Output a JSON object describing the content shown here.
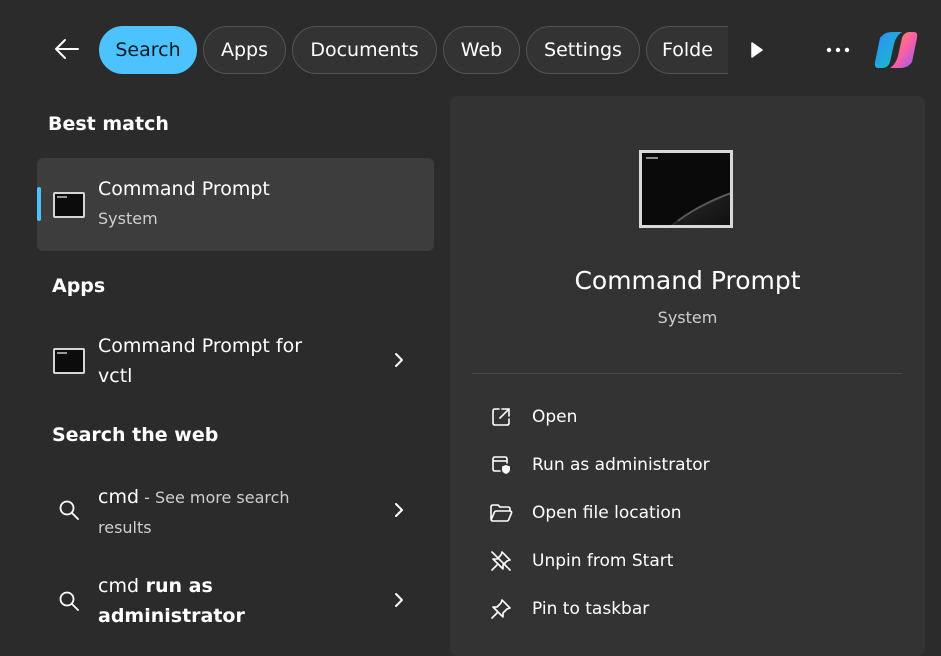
{
  "top_bar": {
    "filters": [
      "Search",
      "Apps",
      "Documents",
      "Web",
      "Settings",
      "Folde"
    ],
    "active_filter": "Search"
  },
  "best_match": {
    "heading": "Best match",
    "title": "Command Prompt",
    "subtitle": "System"
  },
  "apps": {
    "heading": "Apps",
    "items": [
      {
        "line1": "Command Prompt for",
        "line2": "vctl"
      }
    ]
  },
  "web": {
    "heading": "Search the web",
    "items": [
      {
        "query": "cmd",
        "suffix": " - See more search",
        "line2": "results"
      },
      {
        "query": "cmd",
        "suffix": " run as",
        "line2": "administrator"
      }
    ]
  },
  "detail": {
    "title": "Command Prompt",
    "subtitle": "System",
    "actions": [
      {
        "label": "Open",
        "icon": "open-external-icon"
      },
      {
        "label": "Run as administrator",
        "icon": "shield-window-icon"
      },
      {
        "label": "Open file location",
        "icon": "folder-icon"
      },
      {
        "label": "Unpin from Start",
        "icon": "unpin-icon"
      },
      {
        "label": "Pin to taskbar",
        "icon": "pin-icon"
      }
    ]
  },
  "colors": {
    "accent": "#4cc2ff",
    "background": "#2b2b2b",
    "panel": "#333333",
    "selected": "#3d3d3d"
  }
}
